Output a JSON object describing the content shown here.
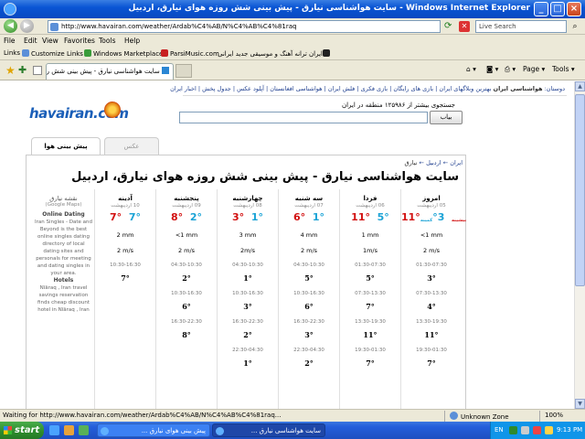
{
  "window": {
    "title": "سایت هواشناسی نیارق - پیش بینی شش روزه هوای نیارق، اردبیل - Windows Internet Explorer"
  },
  "address_bar": {
    "url": "http://www.havairan.com/weather/Ardab%C4%AB/N%C4%AB%C4%81raq",
    "search_placeholder": "Live Search"
  },
  "menu": [
    "File",
    "Edit",
    "View",
    "Favorites",
    "Tools",
    "Help"
  ],
  "links_bar": {
    "label": "Links",
    "items": [
      "Customize Links",
      "Windows Marketplace",
      "ParsiMusic.com",
      "ایران ترانه آهنگ و موسیقی جدید ایرانی"
    ]
  },
  "tab_bar": {
    "tab_title": "سایت هواشناسی نیارق - پیش بینی شش روزه هوای ن...",
    "page_label": "Page",
    "tools_label": "Tools"
  },
  "site": {
    "logo": "havairan.com",
    "topnav": {
      "label": "دوستان:",
      "current": "هواشناسی ایران",
      "links": "بهترین وبلاگهای ایران | بازی های رایگان | بازی فکری | فلش ایران | هواشناسی افغانستان | آپلود عکس | جدول پخش | اخبار ایران"
    },
    "search_caption": "جستجوی بیشتر از ۱۲۵۹۸۶ منطقه در ایران",
    "search_button": "بیاب",
    "tabs": {
      "forecast": "پیش بینی هوا",
      "photo": "عکس"
    },
    "breadcrumb": {
      "root": "ایران",
      "mid": "اردبیل",
      "current": "نیارق"
    },
    "page_title": "سایت هواشناسی نیارق - پیش بینی شش روزه هوای نیارق، اردبیل"
  },
  "forecast": {
    "days": [
      {
        "day": "امروز",
        "date": "05 اردیبهشت",
        "hi": "11°",
        "lo": "3°",
        "hi_note": "بیشینه",
        "lo_note": "کمینه",
        "rain": "<1 mm",
        "wind": "2 m/s",
        "periods": [
          [
            "01:30-07:30",
            "3°"
          ],
          [
            "07:30-13:30",
            "4°"
          ],
          [
            "13:30-19:30",
            "11°"
          ],
          [
            "19:30-01:30",
            "7°"
          ]
        ]
      },
      {
        "day": "فردا",
        "date": "06 اردیبهشت",
        "hi": "11°",
        "lo": "5°",
        "hi_note": "",
        "lo_note": "",
        "rain": "1 mm",
        "wind": "1m/s",
        "periods": [
          [
            "01:30-07:30",
            "5°"
          ],
          [
            "07:30-13:30",
            "7°"
          ],
          [
            "13:30-19:30",
            "11°"
          ],
          [
            "19:30-01:30",
            "7°"
          ]
        ]
      },
      {
        "day": "سه شنبه",
        "date": "07 اردیبهشت",
        "hi": "6°",
        "lo": "1°",
        "hi_note": "",
        "lo_note": "",
        "rain": "4 mm",
        "wind": "2 m/s",
        "periods": [
          [
            "04:30-10:30",
            "5°"
          ],
          [
            "10:30-16:30",
            "6°"
          ],
          [
            "16:30-22:30",
            "3°"
          ],
          [
            "22:30-04:30",
            "2°"
          ]
        ]
      },
      {
        "day": "چهارشنبه",
        "date": "08 اردیبهشت",
        "hi": "3°",
        "lo": "1°",
        "hi_note": "",
        "lo_note": "",
        "rain": "3 mm",
        "wind": "2m/s",
        "periods": [
          [
            "04:30-10:30",
            "1°"
          ],
          [
            "10:30-16:30",
            "3°"
          ],
          [
            "16:30-22:30",
            "2°"
          ],
          [
            "22:30-04:30",
            "1°"
          ]
        ]
      },
      {
        "day": "پنجشنبه",
        "date": "09 اردیبهشت",
        "hi": "8°",
        "lo": "2°",
        "hi_note": "",
        "lo_note": "",
        "rain": "<1 mm",
        "wind": "2 m/s",
        "periods": [
          [
            "04:30-10:30",
            "2°"
          ],
          [
            "10:30-16:30",
            "6°"
          ],
          [
            "16:30-22:30",
            "8°"
          ],
          [
            "",
            ""
          ]
        ]
      },
      {
        "day": "آدینه",
        "date": "10 اردیبهشت",
        "hi": "7°",
        "lo": "7°",
        "hi_note": "",
        "lo_note": "",
        "rain": "2 mm",
        "wind": "2 m/s",
        "periods": [
          [
            "10:30-16:30",
            "7°"
          ],
          [
            "",
            ""
          ],
          [
            "",
            ""
          ],
          [
            "",
            ""
          ]
        ]
      }
    ],
    "side": {
      "map_title": "نقشه نیارق",
      "map_sub": "(Google Maps)",
      "dating_title": "Online Dating",
      "dating_text": "Iran Singles - Date and Beyond is the best online singles dating directory of local dating sites and personals for meeting and dating singles in your area.",
      "hotels_title": "Hotels",
      "hotels_text": "Nīāraq , Iran travel savings reservation finds cheap discount hotel in Nīāraq , Iran"
    }
  },
  "status_bar": {
    "message": "Waiting for http://www.havairan.com/weather/Ardab%C4%AB/N%C4%AB%C4%81raq...",
    "zone": "Unknown Zone",
    "zoom": "100%"
  },
  "taskbar": {
    "start": "start",
    "tasks": [
      "پیش بینی هوای نیارق ...",
      "سایت هواشناسی نیارق ..."
    ],
    "lang": "EN",
    "clock": "9:13 PM"
  }
}
